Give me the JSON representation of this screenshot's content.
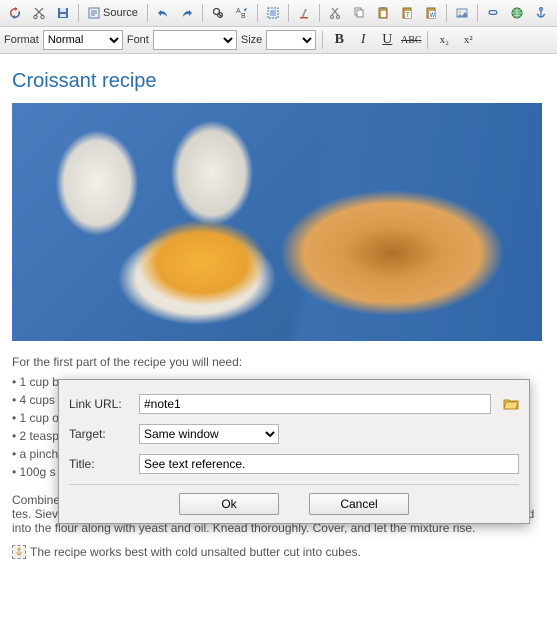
{
  "toolbar": {
    "source_label": "Source"
  },
  "formatbar": {
    "format_label": "Format",
    "format_value": "Normal",
    "font_label": "Font",
    "font_value": "",
    "size_label": "Size",
    "size_value": "",
    "bold": "B",
    "italic": "I",
    "underline": "U",
    "strike": "ABC",
    "sub": "x₂",
    "sup": "x²"
  },
  "content": {
    "title": "Croissant recipe",
    "intro": "For the first part of the recipe you will need:",
    "ingredients": [
      "• 1 cup b",
      "• 4 cups",
      "• 1 cup o",
      "• 2 teasp",
      "• a pinch",
      "• 100g s"
    ],
    "body1": "Combine                                                                                                                                                         tes. Sieve the flour into a large bowl. Dissolve two teaspoons of sugar and salt in warm milk. Blend into the flour along with yeast and oil. Knead thoroughly. Cover, and let the mixture rise.",
    "footnote": "The recipe works best with cold unsalted butter cut into cubes."
  },
  "dialog": {
    "url_label": "Link URL:",
    "url_value": "#note1",
    "target_label": "Target:",
    "target_value": "Same window",
    "title_label": "Title:",
    "title_value": "See text reference.",
    "ok": "Ok",
    "cancel": "Cancel"
  }
}
